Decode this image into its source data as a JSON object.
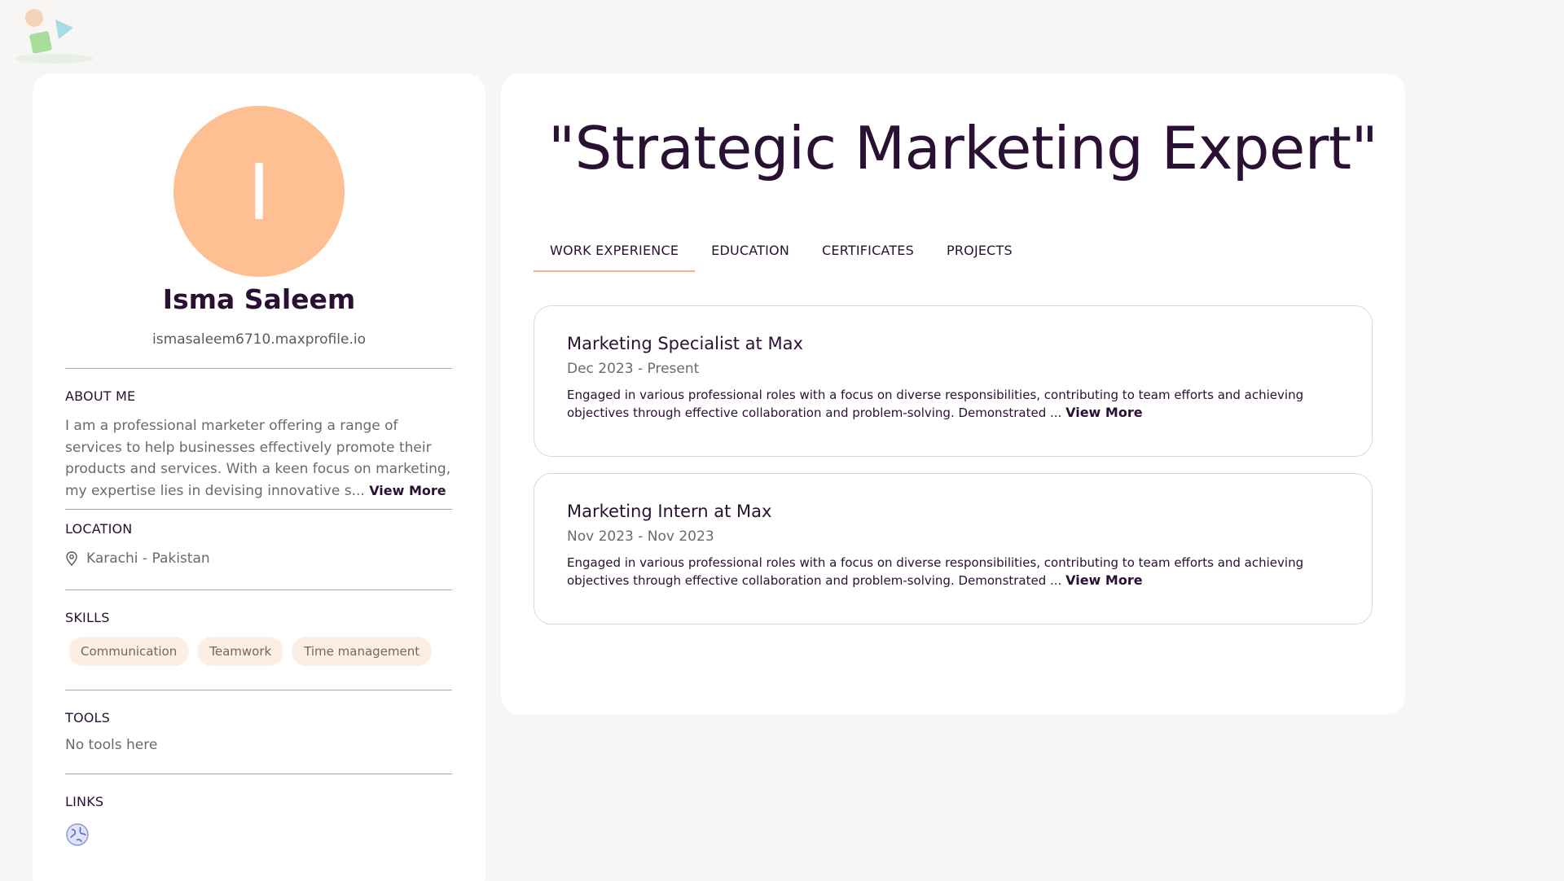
{
  "colors": {
    "accent": "#fec092",
    "accent_line": "#f2b48a",
    "chip_bg": "#fdeee4",
    "text_dark": "#2a1033",
    "page_bg": "#f7f6f4"
  },
  "profile": {
    "avatar_initial": "I",
    "name": "Isma Saleem",
    "url": "ismasaleem6710.maxprofile.io",
    "about": {
      "title": "ABOUT ME",
      "text": "I am a professional marketer offering a range of services to help businesses effectively promote their products and services. With a keen focus on marketing, my expertise lies in devising innovative s...",
      "view_more": "View More"
    },
    "location": {
      "title": "LOCATION",
      "icon": "map-pin-icon",
      "value": "Karachi - Pakistan"
    },
    "skills": {
      "title": "SKILLS",
      "items": [
        "Communication",
        "Teamwork",
        "Time management"
      ]
    },
    "tools": {
      "title": "TOOLS",
      "empty_text": "No tools here"
    },
    "links": {
      "title": "LINKS",
      "icon": "globe-icon"
    }
  },
  "main": {
    "headline": "\"Strategic Marketing Expert\"",
    "tabs": [
      {
        "label": "WORK EXPERIENCE",
        "active": true
      },
      {
        "label": "EDUCATION",
        "active": false
      },
      {
        "label": "CERTIFICATES",
        "active": false
      },
      {
        "label": "PROJECTS",
        "active": false
      }
    ],
    "experience": [
      {
        "title": "Marketing Specialist at Max",
        "dates": "Dec 2023 - Present",
        "description": "Engaged in various professional roles with a focus on diverse responsibilities, contributing to team efforts and achieving objectives through effective collaboration and problem-solving. Demonstrated ...",
        "view_more": "View More"
      },
      {
        "title": "Marketing Intern at Max",
        "dates": "Nov 2023 - Nov 2023",
        "description": "Engaged in various professional roles with a focus on diverse responsibilities, contributing to team efforts and achieving objectives through effective collaboration and problem-solving. Demonstrated ...",
        "view_more": "View More"
      }
    ]
  }
}
